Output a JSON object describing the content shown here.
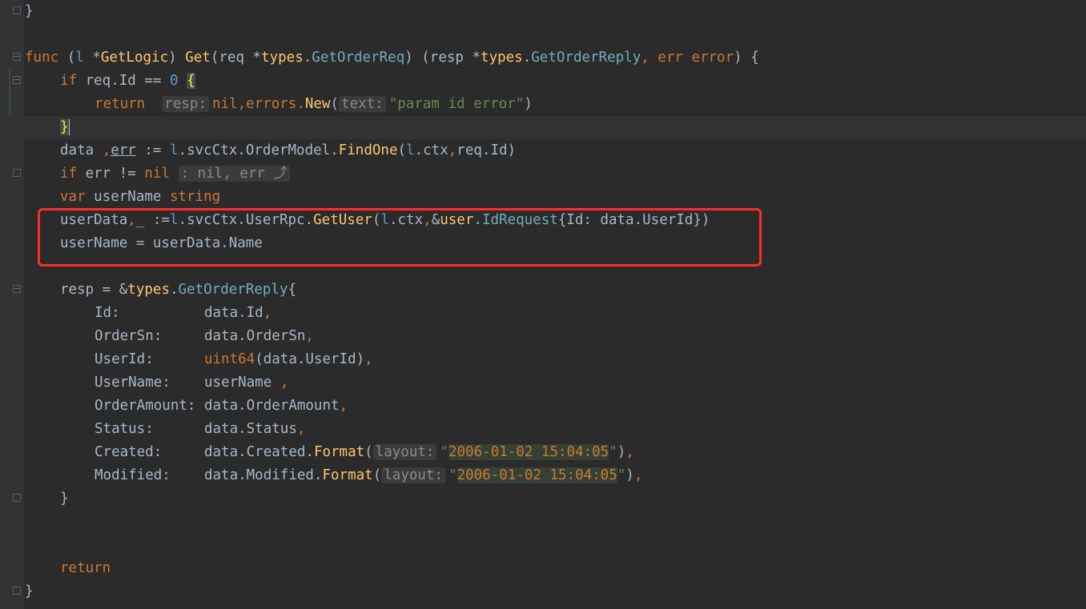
{
  "editor": {
    "lines": {
      "l1": "}",
      "l3_func": "func",
      "l3_open": " (",
      "l3_recv": "l",
      "l3_star": " *",
      "l3_type": "GetLogic",
      "l3_close": ") ",
      "l3_name": "Get",
      "l3_params1": "(req *",
      "l3_types": "types",
      "l3_dot": ".",
      "l3_reqtype": "GetOrderReq",
      "l3_params2": ") (resp *",
      "l3_types2": "types",
      "l3_dot2": ".",
      "l3_replytype": "GetOrderReply",
      "l3_comma": ", err ",
      "l3_error": "error",
      "l3_end": ") {",
      "l4_if": "if",
      "l4_cond": " req.Id == ",
      "l4_zero": "0",
      "l4_brace": "{",
      "l5_return": "return",
      "l5_hint1": "resp:",
      "l5_nil": "nil",
      "l5_comma": ",errors.",
      "l5_new": "New",
      "l5_paren": "(",
      "l5_hint2": "text:",
      "l5_str": "\"param id error\"",
      "l5_close": ")",
      "l6_brace": "}",
      "l7_a": "data ",
      "l7_comma": ",",
      "l7_err": "err",
      "l7_b": " := ",
      "l7_l": "l",
      "l7_c": ".svcCtx.OrderModel.",
      "l7_find": "FindOne",
      "l7_d": "(",
      "l7_l2": "l",
      "l7_e": ".ctx",
      "l7_comma2": ",",
      "l7_f": "req.Id)",
      "l8_if": "if",
      "l8_cond": " err != ",
      "l8_nil": "nil",
      "l8_fold": ": nil, err ⤴",
      "l9_var": "var",
      "l9_name": " userName ",
      "l9_string": "string",
      "l10_a": "userData",
      "l10_comma": ",",
      "l10_b": "_ :=",
      "l10_l": "l",
      "l10_c": ".svcCtx.UserRpc.",
      "l10_get": "GetUser",
      "l10_d": "(",
      "l10_l2": "l",
      "l10_e": ".ctx",
      "l10_comma2": ",",
      "l10_amp": "&",
      "l10_user": "user",
      "l10_dot": ".",
      "l10_idreq": "IdRequest",
      "l10_f": "{Id: data.UserId})",
      "l11": "userName = userData.Name",
      "l13_a": "resp = &",
      "l13_types": "types",
      "l13_dot": ".",
      "l13_reply": "GetOrderReply",
      "l13_b": "{",
      "f_id_k": "Id:          ",
      "f_id_v": "data.Id",
      "f_sn_k": "OrderSn:     ",
      "f_sn_v": "data.OrderSn",
      "f_uid_k": "UserId:      ",
      "f_uid_fn": "uint64",
      "f_uid_v": "(data.UserId)",
      "f_un_k": "UserName:    ",
      "f_un_v": "userName ",
      "f_oa_k": "OrderAmount: ",
      "f_oa_v": "data.OrderAmount",
      "f_st_k": "Status:      ",
      "f_st_v": "data.Status",
      "f_cr_k": "Created:     ",
      "f_cr_v": "data.Created.",
      "f_cr_fmt": "Format",
      "f_cr_p": "(",
      "f_cr_hint": "layout:",
      "f_cr_q1": "\"",
      "f_cr_str": "2006-01-02 15:04:05",
      "f_cr_q2": "\"",
      "f_cr_end": ")",
      "f_md_k": "Modified:    ",
      "f_md_v": "data.Modified.",
      "f_md_fmt": "Format",
      "f_md_p": "(",
      "f_md_hint": "layout:",
      "f_md_q1": "\"",
      "f_md_str": "2006-01-02 15:04:05",
      "f_md_q2": "\"",
      "f_md_end": ")",
      "comma": ",",
      "l22": "}",
      "l25_return": "return",
      "l26": "}"
    }
  }
}
